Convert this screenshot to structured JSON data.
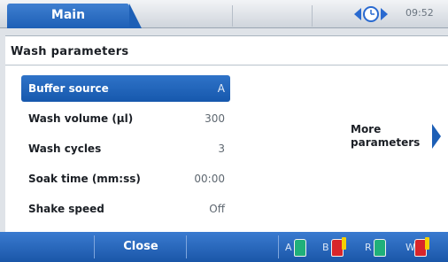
{
  "tabs": {
    "main_label": "Main"
  },
  "status": {
    "time": "09:52",
    "icon": "sync-clock-icon"
  },
  "panel": {
    "title": "Wash parameters"
  },
  "parameters": [
    {
      "label": "Buffer source",
      "value": "A"
    },
    {
      "label": "Wash volume (µl)",
      "value": "300"
    },
    {
      "label": "Wash cycles",
      "value": "3"
    },
    {
      "label": "Soak time (mm:ss)",
      "value": "00:00"
    },
    {
      "label": "Shake speed",
      "value": "Off"
    }
  ],
  "more": {
    "label": "More parameters"
  },
  "footer": {
    "close_label": "Close",
    "bottles": [
      {
        "letter": "A",
        "color": "#20b07a",
        "warning": false
      },
      {
        "letter": "B",
        "color": "#d8252a",
        "warning": true
      },
      {
        "letter": "R",
        "color": "#20b07a",
        "warning": false
      },
      {
        "letter": "W",
        "color": "#d8252a",
        "warning": true
      }
    ]
  },
  "colors": {
    "accent": "#1d5fb6",
    "panel_bg": "#ffffff"
  }
}
